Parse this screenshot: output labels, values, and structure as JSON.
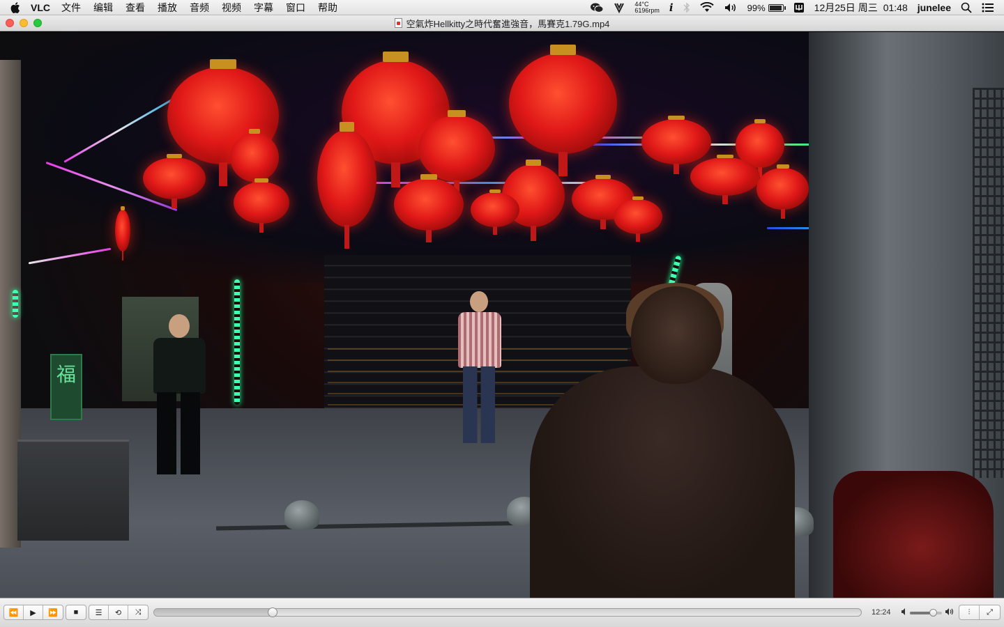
{
  "menubar": {
    "apple_icon": "apple-icon",
    "app_name": "VLC",
    "menus": [
      "文件",
      "编辑",
      "查看",
      "播放",
      "音频",
      "视频",
      "字幕",
      "窗口",
      "帮助"
    ],
    "status": {
      "temperature": "44°C",
      "fan_speed": "6196rpm",
      "battery_percent": "99%",
      "battery_level": 0.99,
      "date": "12月25日 周三",
      "time": "01:48",
      "user": "junelee"
    }
  },
  "window": {
    "title": "空氣炸Hellkitty之時代奮進強音，馬賽克1.79G.mp4"
  },
  "video": {
    "sign_text": "福"
  },
  "controls": {
    "rewind_icon": "⏪",
    "play_icon": "▶",
    "forward_icon": "⏩",
    "stop_icon": "■",
    "playlist_icon": "☰",
    "loop_icon": "⟲",
    "shuffle_icon": "⤨",
    "position_fraction": 0.168,
    "elapsed_time": "12:24",
    "volume_fraction": 0.72,
    "eq_icon": "⫶",
    "fullscreen_icon": "⤢"
  }
}
